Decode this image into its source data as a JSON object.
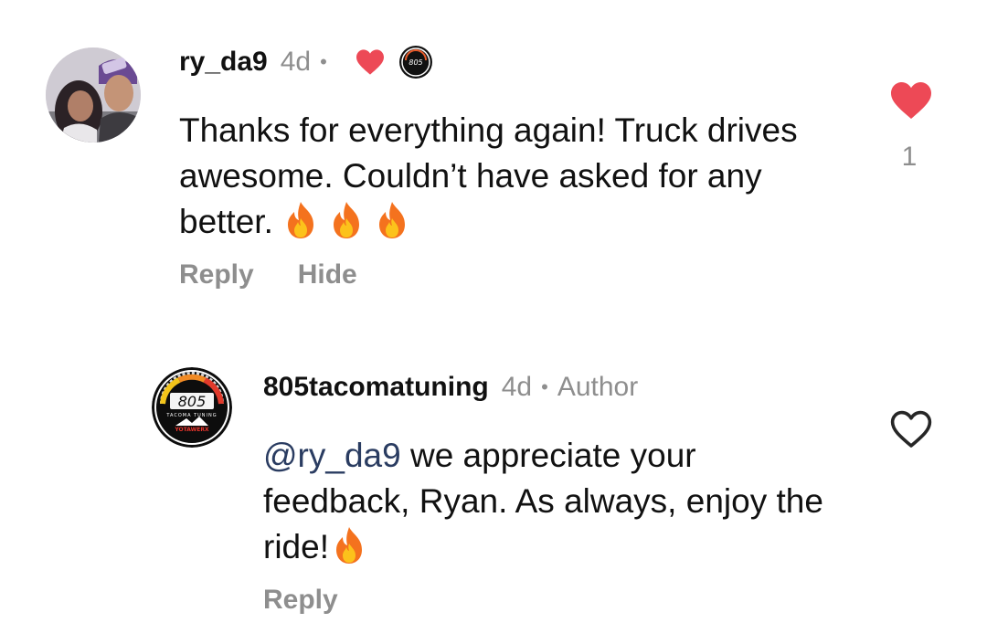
{
  "comments": [
    {
      "username": "ry_da9",
      "time": "4d",
      "separator": "•",
      "text": "Thanks for everything again! Truck drives awesome. Couldn’t have asked for any better.",
      "emoji_count": 3,
      "actions": {
        "reply": "Reply",
        "hide": "Hide"
      },
      "liked": true,
      "like_count": "1",
      "author_liked_icon": "heart-icon",
      "badge_icon": "805-badge-icon",
      "avatar_icon": "user-avatar"
    },
    {
      "username": "805tacomatuning",
      "time": "4d",
      "separator": "•",
      "author_label": "Author",
      "mention": "@ry_da9",
      "text": " we appreciate your feedback, Ryan. As always, enjoy the ride!",
      "emoji_count": 1,
      "actions": {
        "reply": "Reply"
      },
      "liked": false,
      "avatar_icon": "805-tacoma-tuning-logo",
      "logo_text": "805",
      "logo_subtext": "TACOMA TUNING",
      "logo_brand": "YOTAWERX"
    }
  ],
  "colors": {
    "heart_red": "#ed4956",
    "meta_gray": "#8e8e8e",
    "mention_blue": "#2a3c61",
    "text": "#111111"
  }
}
